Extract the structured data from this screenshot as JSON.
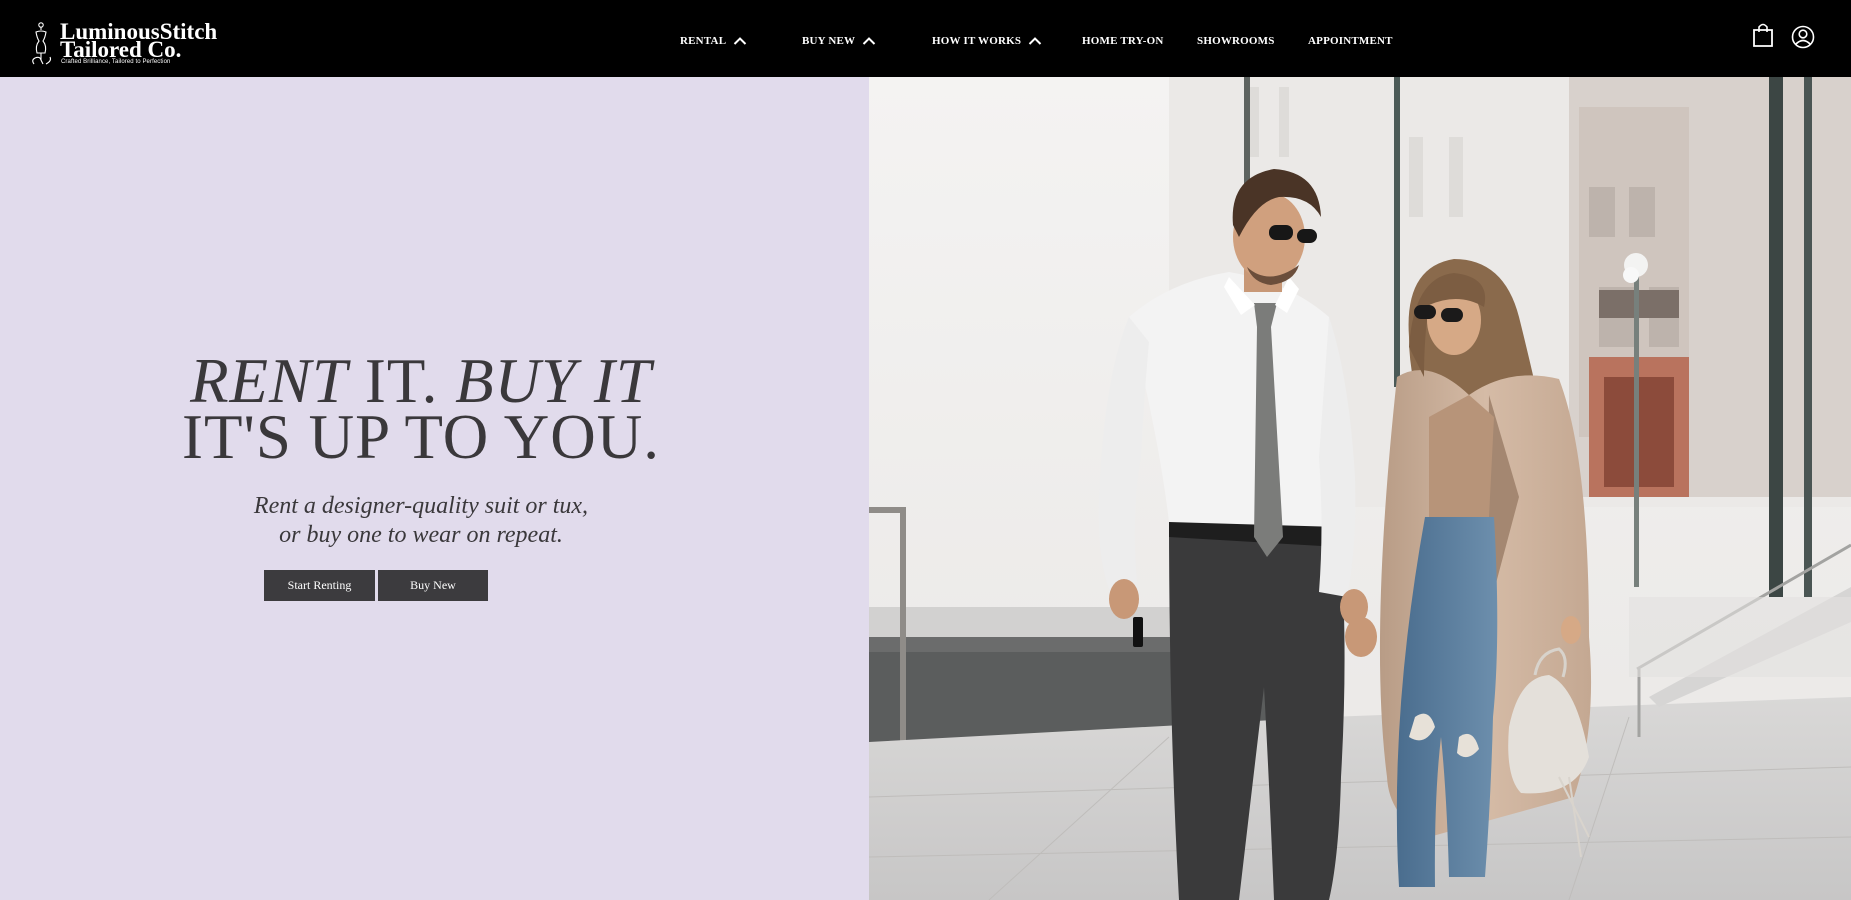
{
  "brand": {
    "line1": "LuminousStitch",
    "line2": "Tailored Co.",
    "tagline": "Crafted Brilliance, Tailored to Perfection"
  },
  "nav": {
    "items": [
      {
        "label": "RENTAL",
        "has_chevron": true
      },
      {
        "label": "BUY NEW",
        "has_chevron": true
      },
      {
        "label": "HOW IT WORKS",
        "has_chevron": true
      },
      {
        "label": "HOME TRY-ON",
        "has_chevron": false
      },
      {
        "label": "SHOWROOMS",
        "has_chevron": false
      },
      {
        "label": "APPOINTMENT",
        "has_chevron": false
      }
    ],
    "icons": [
      "shopping-bag-icon",
      "user-account-icon"
    ]
  },
  "hero": {
    "headline_part1_italic": "RENT",
    "headline_part2": " IT. ",
    "headline_part3_italic": "BUY IT",
    "headline_line2": "IT'S UP TO YOU.",
    "subtext_line1": "Rent a designer-quality suit or tux,",
    "subtext_line2": "or buy one to wear on repeat.",
    "primary_button": "Start Renting",
    "secondary_button": "Buy New",
    "image_alt": "Couple walking hand in hand on a city sidewalk"
  },
  "colors": {
    "header_bg": "#000000",
    "hero_bg": "#e1dbec",
    "text": "#3a383b",
    "button_bg": "#3c3b3e"
  }
}
